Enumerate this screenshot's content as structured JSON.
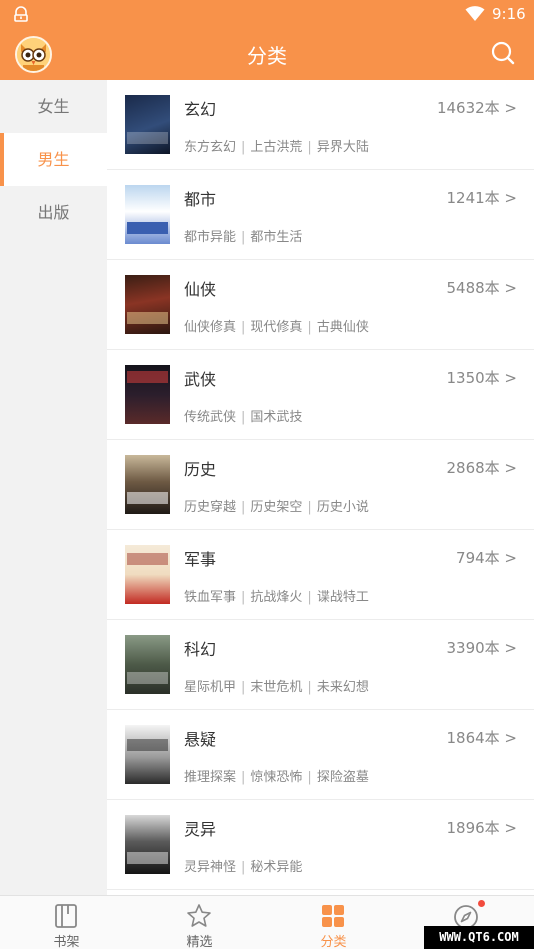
{
  "status_bar": {
    "time": "9:16"
  },
  "header": {
    "title": "分类"
  },
  "sidebar": {
    "items": [
      {
        "label": "女生",
        "active": false
      },
      {
        "label": "男生",
        "active": true
      },
      {
        "label": "出版",
        "active": false
      }
    ]
  },
  "categories": [
    {
      "name": "玄幻",
      "count": "14632本 >",
      "tags": [
        "东方玄幻",
        "上古洪荒",
        "异界大陆"
      ]
    },
    {
      "name": "都市",
      "count": "1241本 >",
      "tags": [
        "都市异能",
        "都市生活"
      ]
    },
    {
      "name": "仙侠",
      "count": "5488本 >",
      "tags": [
        "仙侠修真",
        "现代修真",
        "古典仙侠"
      ]
    },
    {
      "name": "武侠",
      "count": "1350本 >",
      "tags": [
        "传统武侠",
        "国术武技"
      ]
    },
    {
      "name": "历史",
      "count": "2868本 >",
      "tags": [
        "历史穿越",
        "历史架空",
        "历史小说"
      ]
    },
    {
      "name": "军事",
      "count": "794本 >",
      "tags": [
        "铁血军事",
        "抗战烽火",
        "谍战特工"
      ]
    },
    {
      "name": "科幻",
      "count": "3390本 >",
      "tags": [
        "星际机甲",
        "末世危机",
        "未来幻想"
      ]
    },
    {
      "name": "悬疑",
      "count": "1864本 >",
      "tags": [
        "推理探案",
        "惊悚恐怖",
        "探险盗墓"
      ]
    },
    {
      "name": "灵异",
      "count": "1896本 >",
      "tags": [
        "灵异神怪",
        "秘术异能"
      ]
    }
  ],
  "bottom_tabs": [
    {
      "label": "书架",
      "icon": "bookshelf-icon",
      "active": false
    },
    {
      "label": "精选",
      "icon": "star-icon",
      "active": false
    },
    {
      "label": "分类",
      "icon": "grid-icon",
      "active": true
    },
    {
      "label": "发现",
      "icon": "compass-icon",
      "active": false
    }
  ],
  "watermark": "WWW.QT6.COM",
  "colors": {
    "accent": "#f8924a",
    "badge": "#f24b3d"
  }
}
